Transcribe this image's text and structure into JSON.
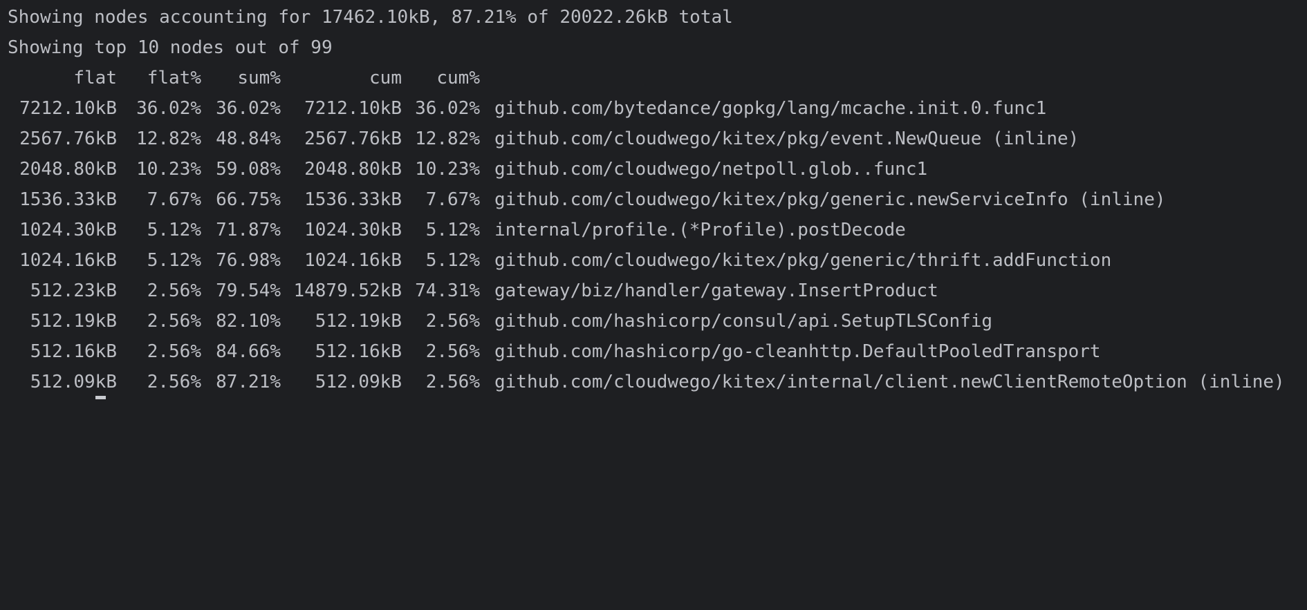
{
  "summary": {
    "accounting": "Showing nodes accounting for 17462.10kB, 87.21% of 20022.26kB total",
    "top": "Showing top 10 nodes out of 99"
  },
  "headers": {
    "flat": "flat",
    "flat_pct": "flat%",
    "sum_pct": "sum%",
    "cum": "cum",
    "cum_pct": "cum%"
  },
  "rows": [
    {
      "flat": "7212.10kB",
      "flat_pct": "36.02%",
      "sum_pct": "36.02%",
      "cum": "7212.10kB",
      "cum_pct": "36.02%",
      "name": "github.com/bytedance/gopkg/lang/mcache.init.0.func1"
    },
    {
      "flat": "2567.76kB",
      "flat_pct": "12.82%",
      "sum_pct": "48.84%",
      "cum": "2567.76kB",
      "cum_pct": "12.82%",
      "name": "github.com/cloudwego/kitex/pkg/event.NewQueue (inline)"
    },
    {
      "flat": "2048.80kB",
      "flat_pct": "10.23%",
      "sum_pct": "59.08%",
      "cum": "2048.80kB",
      "cum_pct": "10.23%",
      "name": "github.com/cloudwego/netpoll.glob..func1"
    },
    {
      "flat": "1536.33kB",
      "flat_pct": "7.67%",
      "sum_pct": "66.75%",
      "cum": "1536.33kB",
      "cum_pct": "7.67%",
      "name": "github.com/cloudwego/kitex/pkg/generic.newServiceInfo (inline)"
    },
    {
      "flat": "1024.30kB",
      "flat_pct": "5.12%",
      "sum_pct": "71.87%",
      "cum": "1024.30kB",
      "cum_pct": "5.12%",
      "name": "internal/profile.(*Profile).postDecode"
    },
    {
      "flat": "1024.16kB",
      "flat_pct": "5.12%",
      "sum_pct": "76.98%",
      "cum": "1024.16kB",
      "cum_pct": "5.12%",
      "name": "github.com/cloudwego/kitex/pkg/generic/thrift.addFunction"
    },
    {
      "flat": "512.23kB",
      "flat_pct": "2.56%",
      "sum_pct": "79.54%",
      "cum": "14879.52kB",
      "cum_pct": "74.31%",
      "name": "gateway/biz/handler/gateway.InsertProduct"
    },
    {
      "flat": "512.19kB",
      "flat_pct": "2.56%",
      "sum_pct": "82.10%",
      "cum": "512.19kB",
      "cum_pct": "2.56%",
      "name": "github.com/hashicorp/consul/api.SetupTLSConfig"
    },
    {
      "flat": "512.16kB",
      "flat_pct": "2.56%",
      "sum_pct": "84.66%",
      "cum": "512.16kB",
      "cum_pct": "2.56%",
      "name": "github.com/hashicorp/go-cleanhttp.DefaultPooledTransport"
    },
    {
      "flat": "512.09kB",
      "flat_pct": "2.56%",
      "sum_pct": "87.21%",
      "cum": "512.09kB",
      "cum_pct": "2.56%",
      "name": "github.com/cloudwego/kitex/internal/client.newClientRemoteOption (inline)"
    }
  ],
  "colors": {
    "background": "#1e1f22",
    "text": "#bcbec4",
    "cursor": "#c9cbd0"
  }
}
